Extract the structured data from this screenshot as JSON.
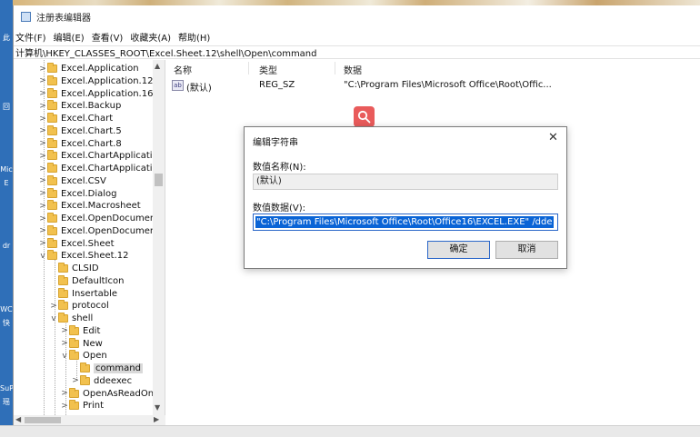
{
  "window": {
    "title": "注册表编辑器"
  },
  "menu": [
    "文件(F)",
    "编辑(E)",
    "查看(V)",
    "收藏夹(A)",
    "帮助(H)"
  ],
  "address": "计算机\\HKEY_CLASSES_ROOT\\Excel.Sheet.12\\shell\\Open\\command",
  "desktop_labels": [
    "此",
    "回",
    "Mic",
    "E",
    "dr",
    "WC",
    "快",
    "SuP",
    "瑶"
  ],
  "tree": [
    {
      "label": "Excel.Application",
      "expand": ">"
    },
    {
      "label": "Excel.Application.12",
      "expand": ">"
    },
    {
      "label": "Excel.Application.16",
      "expand": ">"
    },
    {
      "label": "Excel.Backup",
      "expand": ">"
    },
    {
      "label": "Excel.Chart",
      "expand": ">"
    },
    {
      "label": "Excel.Chart.5",
      "expand": ">"
    },
    {
      "label": "Excel.Chart.8",
      "expand": ">"
    },
    {
      "label": "Excel.ChartApplicatio",
      "expand": ">"
    },
    {
      "label": "Excel.ChartApplicatio",
      "expand": ">"
    },
    {
      "label": "Excel.CSV",
      "expand": ">"
    },
    {
      "label": "Excel.Dialog",
      "expand": ">"
    },
    {
      "label": "Excel.Macrosheet",
      "expand": ">"
    },
    {
      "label": "Excel.OpenDocument",
      "expand": ">"
    },
    {
      "label": "Excel.OpenDocument",
      "expand": ">"
    },
    {
      "label": "Excel.Sheet",
      "expand": ">"
    },
    {
      "label": "Excel.Sheet.12",
      "expand": "v"
    },
    {
      "label": "CLSID",
      "expand": ""
    },
    {
      "label": "DefaultIcon",
      "expand": ""
    },
    {
      "label": "Insertable",
      "expand": ""
    },
    {
      "label": "protocol",
      "expand": ">"
    },
    {
      "label": "shell",
      "expand": "v"
    },
    {
      "label": "Edit",
      "expand": ">"
    },
    {
      "label": "New",
      "expand": ">"
    },
    {
      "label": "Open",
      "expand": "v"
    },
    {
      "label": "command",
      "expand": ""
    },
    {
      "label": "ddeexec",
      "expand": ">"
    },
    {
      "label": "OpenAsReadOn",
      "expand": ">"
    },
    {
      "label": "Print",
      "expand": ">"
    }
  ],
  "list": {
    "headers": {
      "name": "名称",
      "type": "类型",
      "data": "数据"
    },
    "rows": [
      {
        "name": "(默认)",
        "type": "REG_SZ",
        "data": "\"C:\\Program Files\\Microsoft Office\\Root\\Offic..."
      }
    ],
    "value_icon": "ab"
  },
  "dialog": {
    "title": "编辑字符串",
    "name_label": "数值名称(N):",
    "name_value": "(默认)",
    "data_label": "数值数据(V):",
    "data_value": "\"C:\\Program Files\\Microsoft Office\\Root\\Office16\\EXCEL.EXE\" /dde",
    "ok": "确定",
    "cancel": "取消",
    "close_glyph": "✕"
  },
  "colors": {
    "selection": "#0a64d6",
    "accent": "#2a66c8",
    "folder": "#f2c14e",
    "search_bubble": "#e95b5b"
  }
}
